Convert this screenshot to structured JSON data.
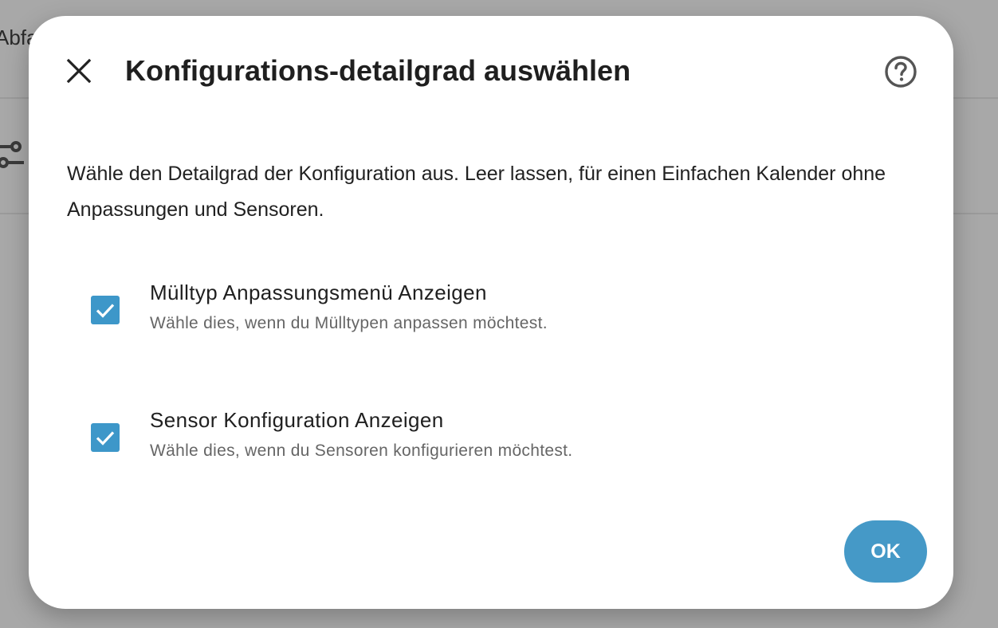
{
  "background": {
    "partial_text": "Abfa"
  },
  "dialog": {
    "title": "Konfigurations-detailgrad auswählen",
    "description": "Wähle den Detailgrad der Konfiguration aus. Leer lassen, für einen Einfachen Kalender ohne Anpassungen und Sensoren.",
    "options": [
      {
        "label": "Mülltyp Anpassungsmenü Anzeigen",
        "sublabel": "Wähle dies, wenn du Mülltypen anpassen möchtest.",
        "checked": true
      },
      {
        "label": "Sensor Konfiguration Anzeigen",
        "sublabel": "Wähle dies, wenn du Sensoren konfigurieren möchtest.",
        "checked": true
      }
    ],
    "ok_label": "OK"
  },
  "colors": {
    "accent": "#4599c7",
    "checkbox": "#3d97c9",
    "backdrop": "#a8a8a8"
  },
  "icons": {
    "close": "close-icon",
    "help": "help-circle-icon",
    "check": "check-icon"
  }
}
